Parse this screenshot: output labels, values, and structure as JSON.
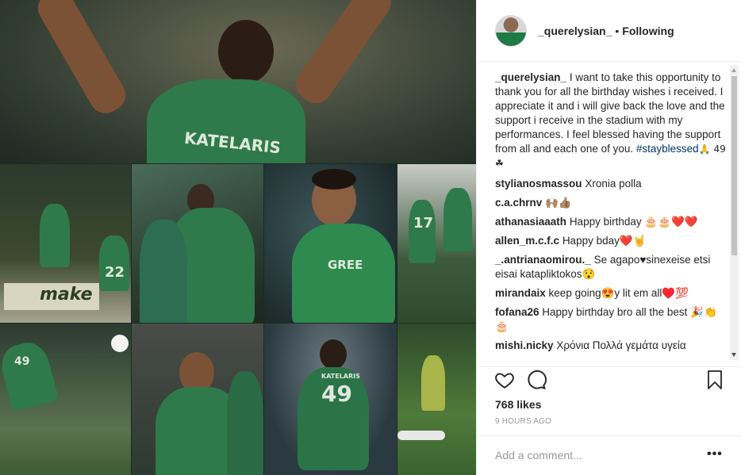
{
  "post": {
    "username": "_querelysian_",
    "separator": "•",
    "follow_status": "Following",
    "caption": {
      "username": "_querelysian_",
      "text": "I want to take this opportunity to thank you for all the birthday wishes i received. I appreciate it and i will give back the love and the support i receive in the stadium with my performances. I feel blessed having the support from all and each one of you.",
      "hashtag": "#stayblessed",
      "suffix": "🙏 49 ☘"
    },
    "comments": [
      {
        "user": "stylianosmassou",
        "text": "Xronia polla"
      },
      {
        "user": "c.a.chrnv",
        "text": "🙌🏽👍🏽"
      },
      {
        "user": "athanasiaaath",
        "text": "Happy birthday 🎂🎂❤️❤️"
      },
      {
        "user": "allen_m.c.f.c",
        "text": "Happy bday❤️🤘"
      },
      {
        "user": "_.antrianaomirou._",
        "text": "Se agapo♥sinexeise etsi eisai katapliktokos😯"
      },
      {
        "user": "mirandaix",
        "text": "keep going😍y lit em all♥️💯"
      },
      {
        "user": "fofana26",
        "text": "Happy birthday bro all the best 🎉👏🎂"
      },
      {
        "user": "mishi.nicky",
        "text": "Χρόνια Πολλά γεμάτα υγεία"
      }
    ],
    "likes": "768 likes",
    "timestamp": "9 HOURS AGO",
    "comment_placeholder": "Add a comment...",
    "more_label": "•••"
  },
  "photo": {
    "jersey_numbers": [
      "22",
      "17",
      "49",
      "49"
    ],
    "jersey_names": [
      "KATELARIS",
      "KATELARIS"
    ],
    "banner_text": "make"
  },
  "icons": [
    "heart-icon",
    "comment-icon",
    "bookmark-icon",
    "more-options-icon"
  ]
}
